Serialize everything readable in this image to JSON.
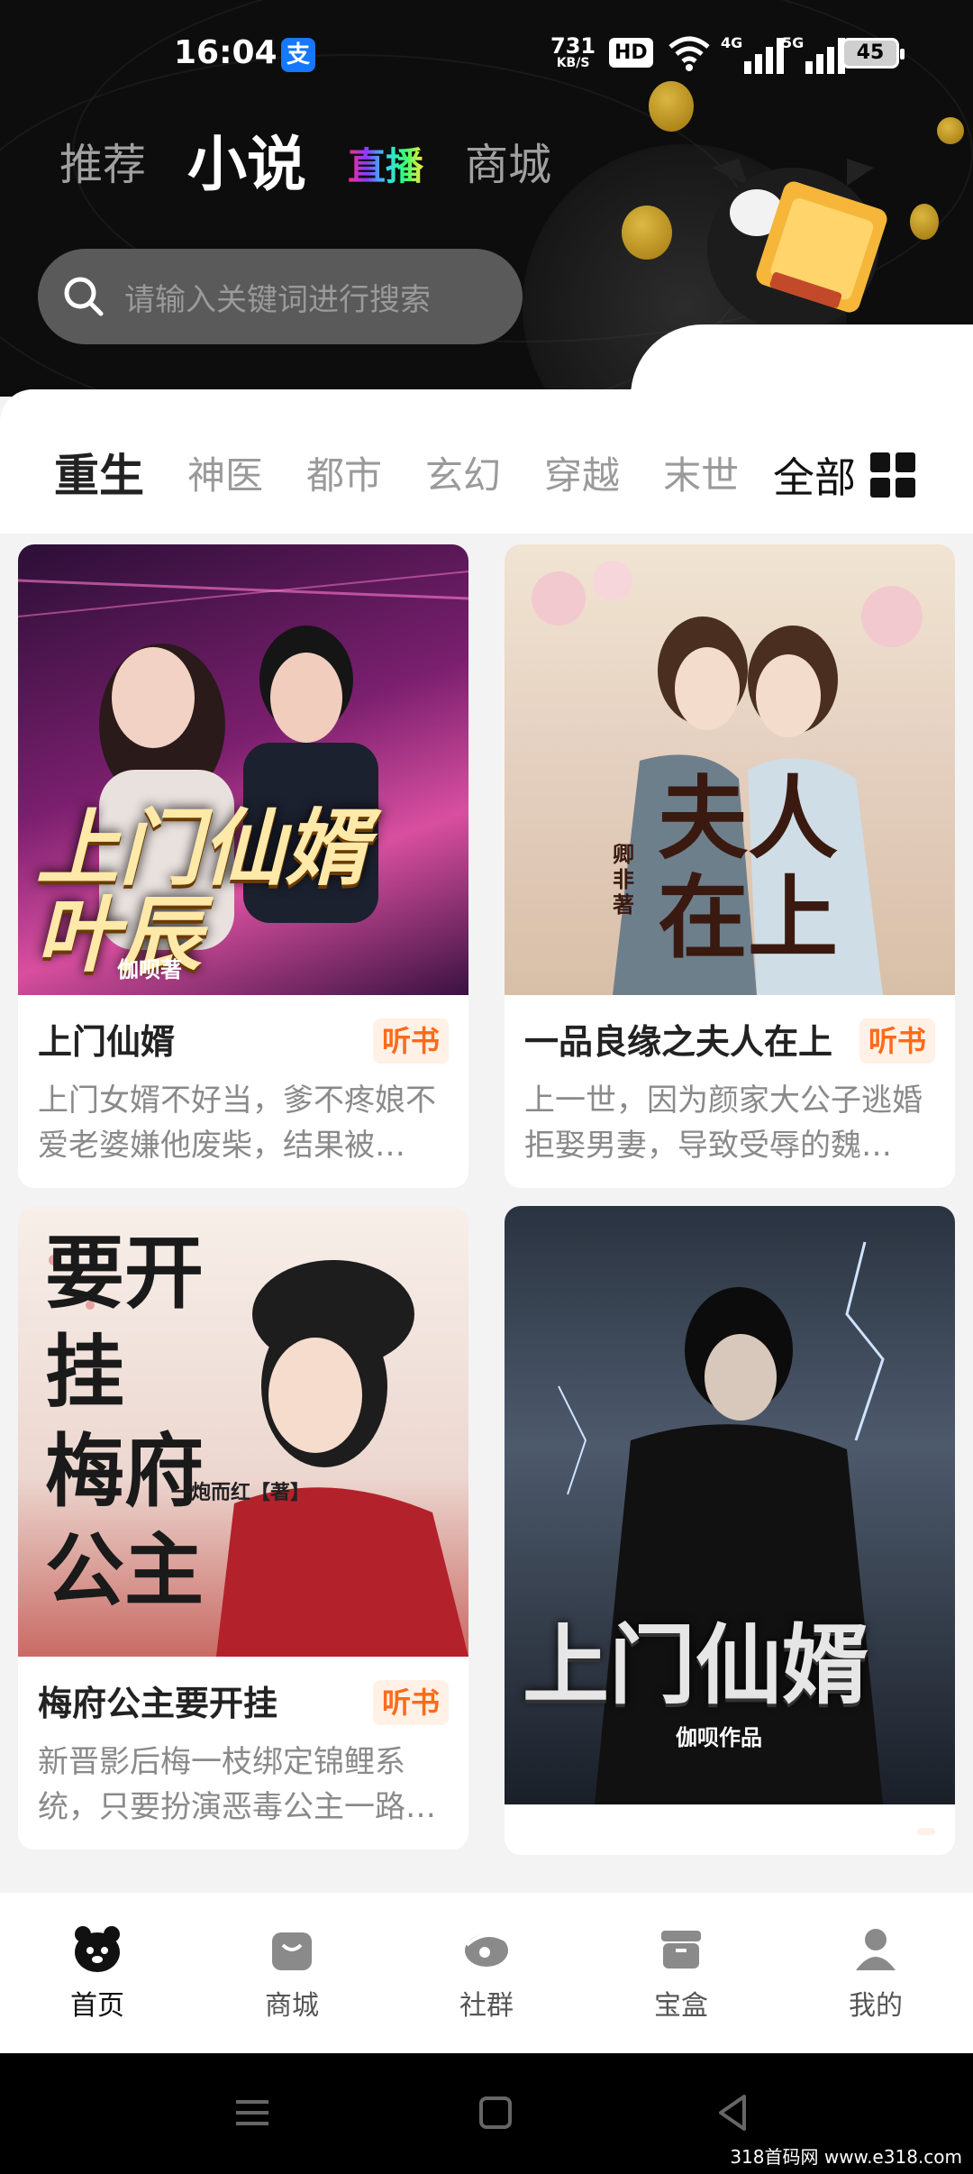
{
  "status_bar": {
    "time": "16:04",
    "alipay_icon": "支",
    "net_speed": "731",
    "net_speed_unit": "KB/S",
    "hd": "HD",
    "signal1_label": "4G",
    "signal2_label": "5G",
    "battery": "45"
  },
  "top_tabs": [
    {
      "label": "推荐",
      "active": false
    },
    {
      "label": "小说",
      "active": true
    },
    {
      "label": "直播",
      "active": false
    },
    {
      "label": "商城",
      "active": false
    }
  ],
  "search": {
    "placeholder": "请输入关键词进行搜索"
  },
  "categories": [
    {
      "label": "重生",
      "active": true
    },
    {
      "label": "神医"
    },
    {
      "label": "都市"
    },
    {
      "label": "玄幻"
    },
    {
      "label": "穿越"
    },
    {
      "label": "末世"
    }
  ],
  "all_categories_label": "全部",
  "books_left": [
    {
      "title": "上门仙婿",
      "badge": "听书",
      "desc": "上门女婿不好当，爹不疼娘不爱老婆嫌他废柴，结果被…",
      "cover_title": "上门仙婿 叶辰",
      "cover_author": "伽呗著",
      "colors": [
        "#3a1242",
        "#c23b8a",
        "#e8b04a"
      ]
    },
    {
      "title": "梅府公主要开挂",
      "badge": "听书",
      "desc": "新晋影后梅一枝绑定锦鲤系统，只要扮演恶毒公主一路…",
      "cover_title": "要开挂 梅府公主",
      "cover_author": "一炮而红【著】",
      "colors": [
        "#f6ece6",
        "#d8b9b2",
        "#b2232a"
      ]
    }
  ],
  "books_right": [
    {
      "title": "一品良缘之夫人在上",
      "badge": "听书",
      "desc": "上一世，因为颜家大公子逃婚拒娶男妻，导致受辱的魏…",
      "cover_title": "夫人在上",
      "cover_author": "卿非著",
      "colors": [
        "#efe1cf",
        "#d9b8b4",
        "#5a3b2c"
      ]
    },
    {
      "title": "",
      "badge": "",
      "desc": "",
      "cover_title": "上门仙婿",
      "cover_author": "伽呗作品",
      "colors": [
        "#1b2330",
        "#5c6a7d",
        "#d9d9d9"
      ]
    }
  ],
  "bottom_nav": [
    {
      "label": "首页",
      "icon": "bear-home-icon",
      "active": true
    },
    {
      "label": "商城",
      "icon": "shopping-bag-icon"
    },
    {
      "label": "社群",
      "icon": "community-icon"
    },
    {
      "label": "宝盒",
      "icon": "treasure-box-icon"
    },
    {
      "label": "我的",
      "icon": "profile-icon"
    }
  ],
  "watermark": "318首码网 www.e318.com"
}
